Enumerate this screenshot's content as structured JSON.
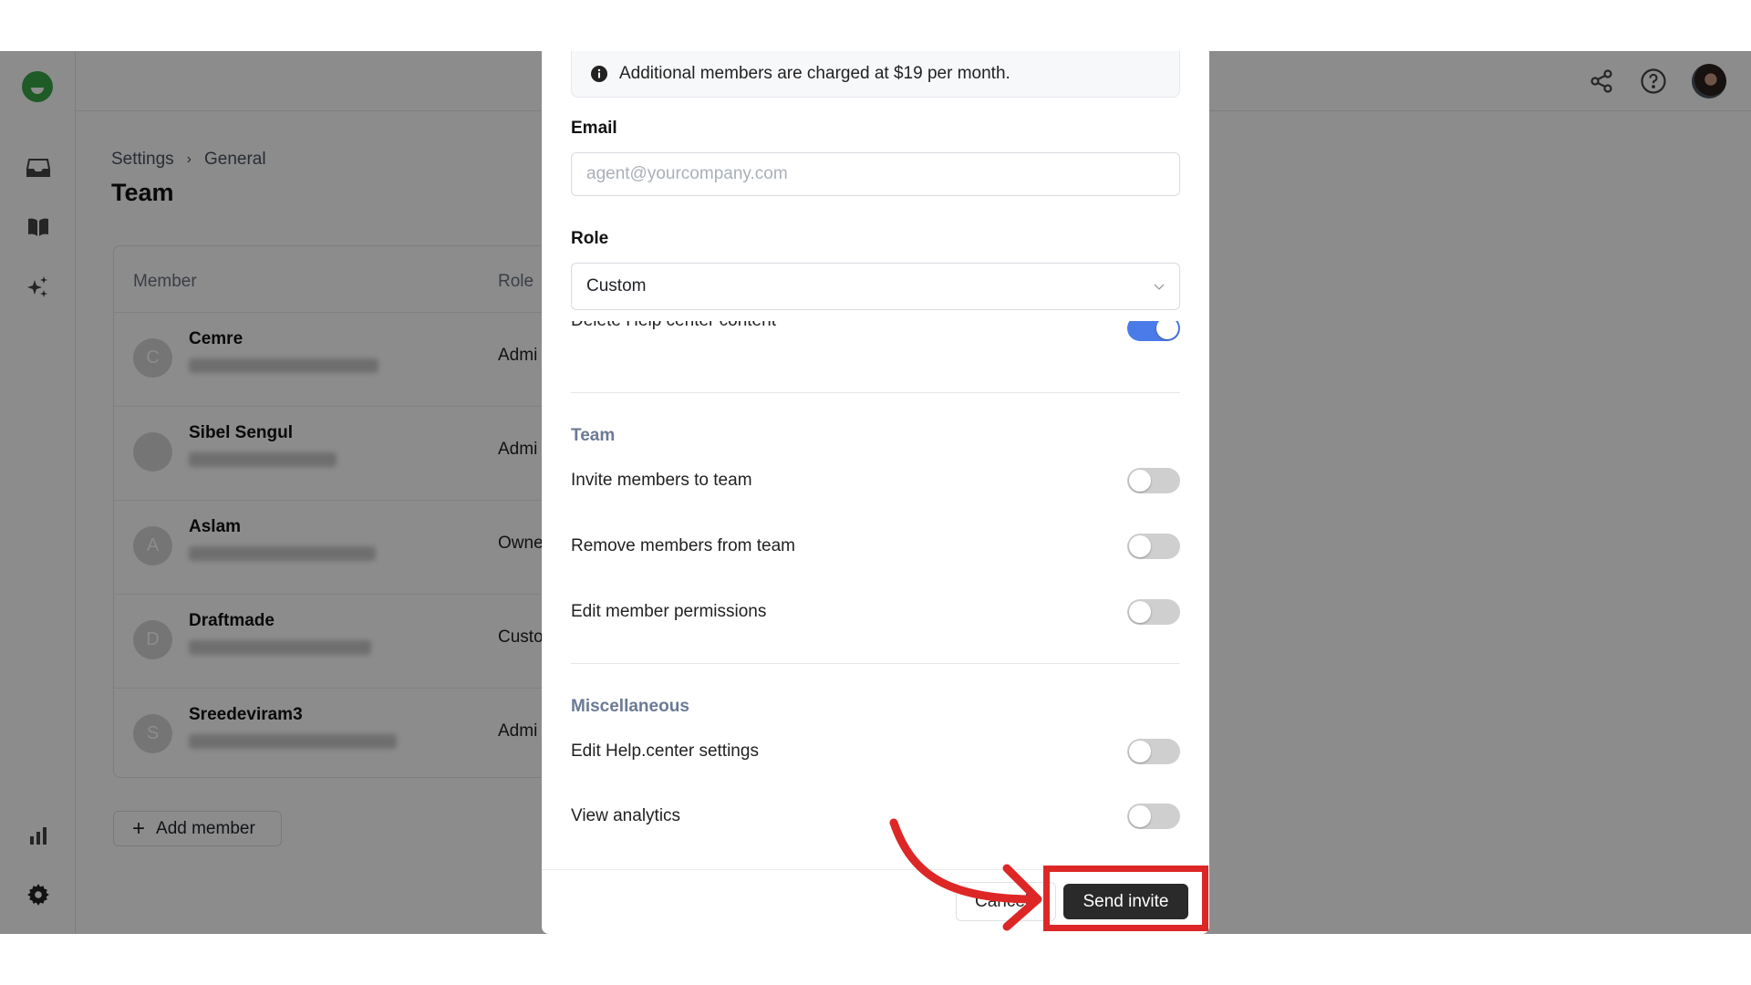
{
  "colors": {
    "accent": "#4a7be8",
    "annotation": "#dd2727",
    "brand": "#3aa645",
    "primary_button": "#2a2a2a"
  },
  "sidebar": {
    "items": [
      {
        "icon": "inbox-icon"
      },
      {
        "icon": "book-icon"
      },
      {
        "icon": "sparkles-icon"
      },
      {
        "icon": "bar-chart-icon"
      },
      {
        "icon": "gear-icon"
      }
    ]
  },
  "topbar": {
    "icons": [
      "share-icon",
      "help-icon",
      "user-avatar"
    ]
  },
  "breadcrumb": {
    "items": [
      "Settings",
      "General"
    ]
  },
  "page": {
    "title": "Team"
  },
  "table": {
    "headers": {
      "member": "Member",
      "role": "Role"
    },
    "rows": [
      {
        "initial": "C",
        "name": "Cemre",
        "role": "Admi"
      },
      {
        "initial": "",
        "name": "Sibel Sengul",
        "role": "Admi"
      },
      {
        "initial": "A",
        "name": "Aslam",
        "role": "Owne"
      },
      {
        "initial": "D",
        "name": "Draftmade",
        "role": "Custo"
      },
      {
        "initial": "S",
        "name": "Sreedeviram3",
        "role": "Admi"
      }
    ]
  },
  "add_member_label": "Add member",
  "modal": {
    "info": "Additional members are charged at $19 per month.",
    "email_label": "Email",
    "email_placeholder": "agent@yourcompany.com",
    "email_value": "",
    "role_label": "Role",
    "role_value": "Custom",
    "partial_permission": {
      "label": "Delete Help center content",
      "enabled": true
    },
    "sections": [
      {
        "title": "Team",
        "permissions": [
          {
            "label": "Invite members to team",
            "enabled": false
          },
          {
            "label": "Remove members from team",
            "enabled": false
          },
          {
            "label": "Edit member permissions",
            "enabled": false
          }
        ]
      },
      {
        "title": "Miscellaneous",
        "permissions": [
          {
            "label": "Edit Help.center settings",
            "enabled": false
          },
          {
            "label": "View analytics",
            "enabled": false
          }
        ]
      }
    ],
    "cancel_label": "Cancel",
    "send_label": "Send invite"
  }
}
